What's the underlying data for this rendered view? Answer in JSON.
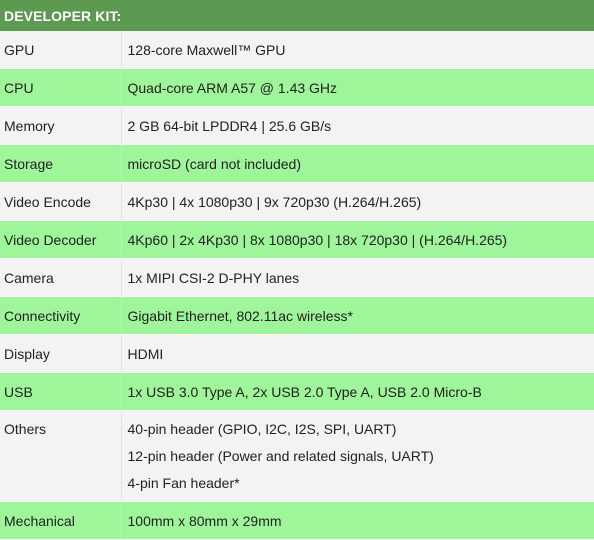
{
  "table": {
    "header": "DEVELOPER KIT:",
    "rows": [
      {
        "label": "GPU",
        "value": "128-core Maxwell™ GPU"
      },
      {
        "label": "CPU",
        "value": "Quad-core ARM A57 @ 1.43 GHz"
      },
      {
        "label": "Memory",
        "value": "2 GB 64-bit LPDDR4 | 25.6 GB/s"
      },
      {
        "label": "Storage",
        "value": "microSD (card not included)"
      },
      {
        "label": "Video Encode",
        "value": "4Kp30 | 4x 1080p30 | 9x 720p30 (H.264/H.265)"
      },
      {
        "label": "Video Decoder",
        "value": "4Kp60 | 2x 4Kp30 | 8x 1080p30 | 18x 720p30 | (H.264/H.265)"
      },
      {
        "label": "Camera",
        "value": "1x MIPI CSI-2 D-PHY lanes"
      },
      {
        "label": "Connectivity",
        "value": "Gigabit Ethernet, 802.11ac wireless*"
      },
      {
        "label": "Display",
        "value": "HDMI"
      },
      {
        "label": "USB",
        "value": "1x USB 3.0 Type A, 2x USB 2.0 Type A, USB 2.0 Micro-B"
      },
      {
        "label": "Others",
        "lines": [
          "40-pin header (GPIO, I2C, I2S, SPI, UART)",
          "12-pin header (Power and related signals, UART)",
          "4-pin Fan header*"
        ]
      },
      {
        "label": "Mechanical",
        "value": "100mm x 80mm x 29mm"
      }
    ]
  },
  "colors": {
    "header_bg": "#5c9a52",
    "row_light": "#f3f3f3",
    "row_green": "#9ff59a"
  }
}
